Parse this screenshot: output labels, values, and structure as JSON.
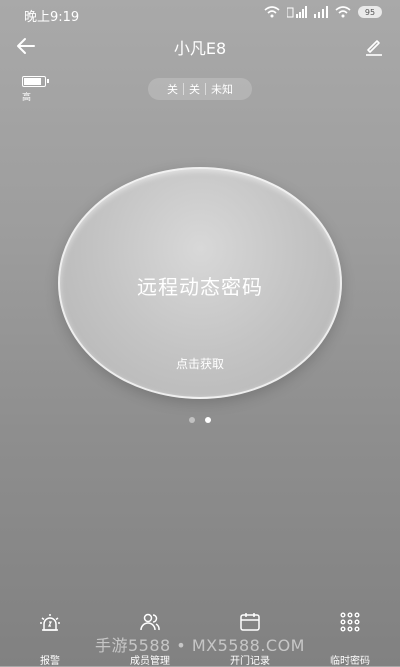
{
  "status_bar": {
    "time": "晚上9:19",
    "battery": "95"
  },
  "header": {
    "title": "小凡E8"
  },
  "device": {
    "battery_level_label": "高",
    "battery_fill": 0.9
  },
  "lock_status": {
    "segments": [
      "关",
      "关",
      "未知"
    ]
  },
  "main_card": {
    "title": "远程动态密码",
    "action": "点击获取"
  },
  "pager": {
    "total": 2,
    "active": 2
  },
  "bottom_nav": {
    "items": [
      {
        "label": "报警",
        "icon": "alarm-icon"
      },
      {
        "label": "成员管理",
        "icon": "members-icon"
      },
      {
        "label": "开门记录",
        "icon": "calendar-icon"
      },
      {
        "label": "临时密码",
        "icon": "keypad-icon"
      }
    ]
  },
  "watermark": "手游5588 • MX5588.COM"
}
